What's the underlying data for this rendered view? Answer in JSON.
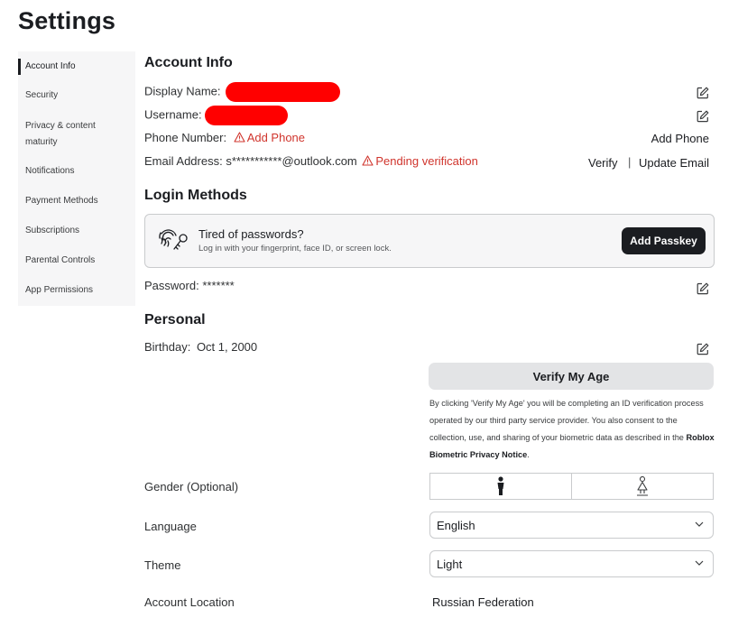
{
  "page": {
    "title": "Settings"
  },
  "sidebar": {
    "items": [
      {
        "label": "Account Info",
        "active": true
      },
      {
        "label": "Security"
      },
      {
        "label": "Privacy & content maturity"
      },
      {
        "label": "Notifications"
      },
      {
        "label": "Payment Methods"
      },
      {
        "label": "Subscriptions"
      },
      {
        "label": "Parental Controls"
      },
      {
        "label": "App Permissions"
      }
    ]
  },
  "account_info": {
    "title": "Account Info",
    "display_name_label": "Display Name:",
    "username_label": "Username:",
    "phone_label": "Phone Number:",
    "phone_warning": "Add Phone",
    "phone_action": "Add Phone",
    "email_label": "Email Address:",
    "email_value": "s***********@outlook.com",
    "email_warning": "Pending verification",
    "verify_action": "Verify",
    "separator": "|",
    "update_email_action": "Update Email"
  },
  "login_methods": {
    "title": "Login Methods",
    "passkey_title": "Tired of passwords?",
    "passkey_subtitle": "Log in with your fingerprint, face ID, or screen lock.",
    "passkey_button": "Add Passkey",
    "password_label": "Password:",
    "password_value": "*******"
  },
  "personal": {
    "title": "Personal",
    "birthday_label": "Birthday:",
    "birthday_value": "Oct 1, 2000",
    "verify_age_button": "Verify My Age",
    "verify_text": "By clicking 'Verify My Age' you will be completing an ID verification process operated by our third party service provider. You also consent to the collection, use, and sharing of your biometric data as described in the",
    "verify_link": "Roblox Biometric Privacy Notice",
    "verify_end": ".",
    "gender_label": "Gender (Optional)",
    "language_label": "Language",
    "language_value": "English",
    "theme_label": "Theme",
    "theme_value": "Light",
    "location_label": "Account Location",
    "location_value": "Russian Federation"
  },
  "colors": {
    "warning": "#d0342c",
    "redaction": "#ff0000",
    "primary_button": "#1b1d21"
  }
}
